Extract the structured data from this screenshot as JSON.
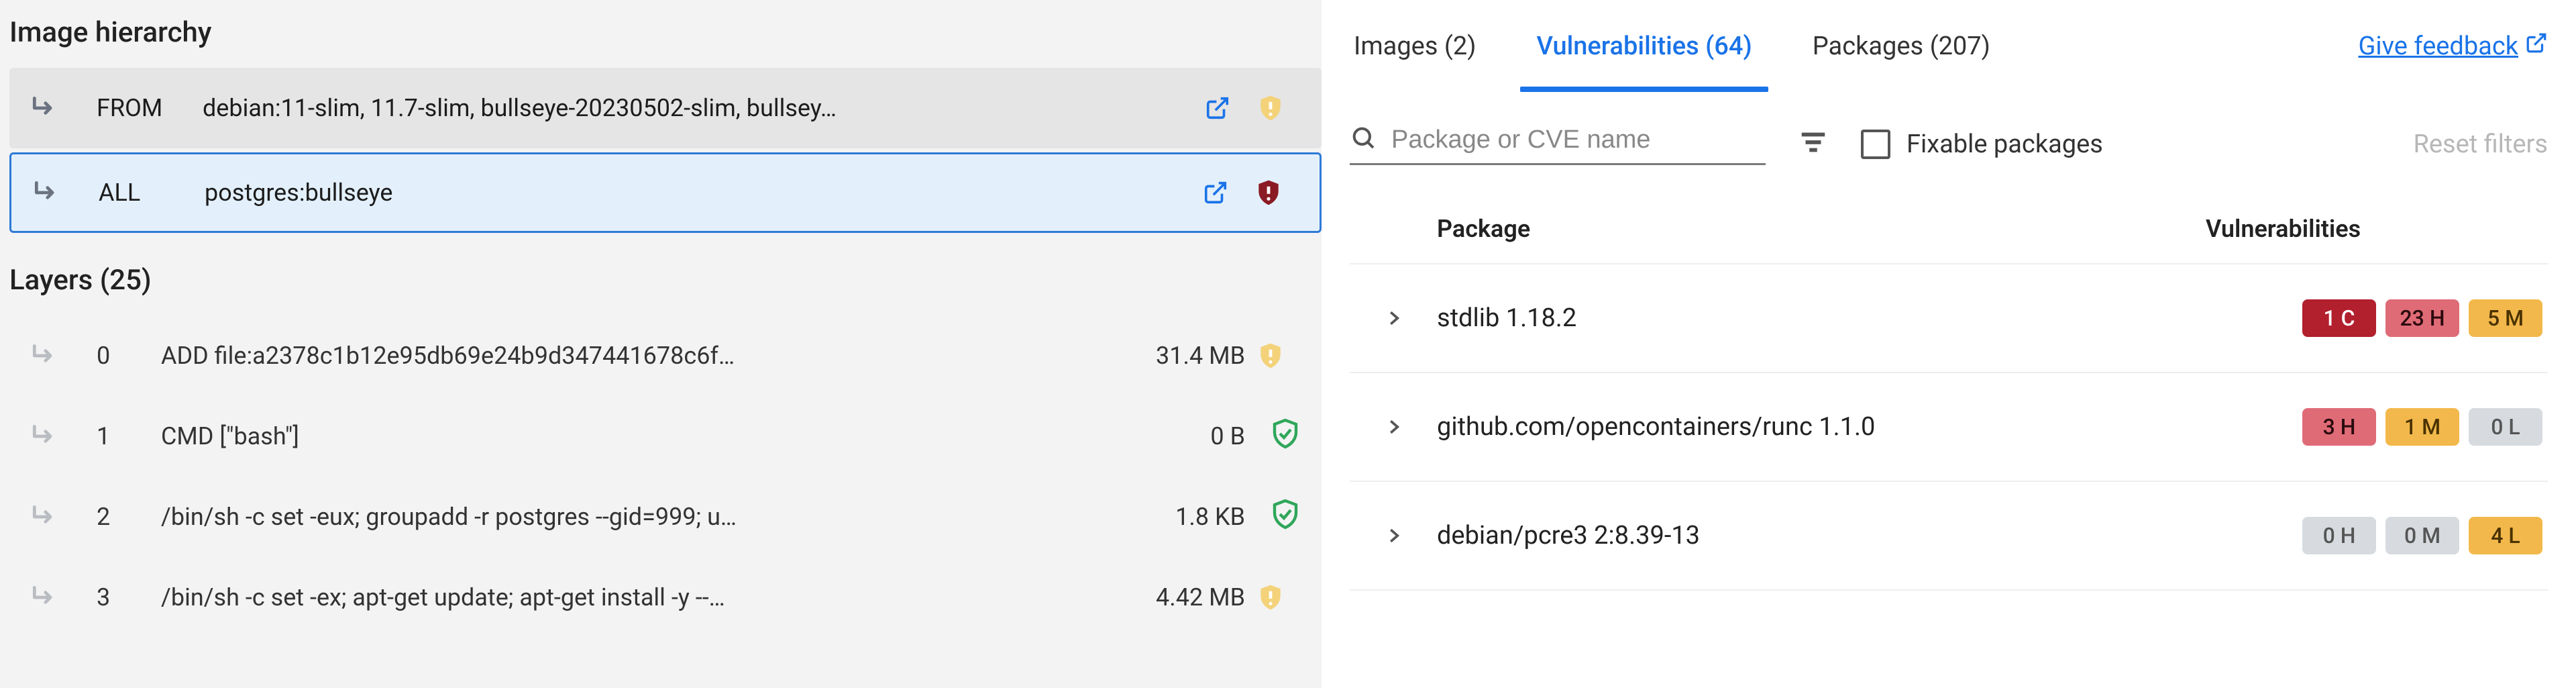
{
  "left": {
    "hierarchy_title": "Image hierarchy",
    "hierarchy": [
      {
        "tag": "FROM",
        "text": "debian:11-slim, 11.7-slim, bullseye-20230502-slim, bullsey…",
        "status": "warn-soft",
        "selected": false
      },
      {
        "tag": "ALL",
        "text": "postgres:bullseye",
        "status": "crit",
        "selected": true
      }
    ],
    "layers_title": "Layers (25)",
    "layers": [
      {
        "idx": "0",
        "cmd": "ADD file:a2378c1b12e95db69e24b9d347441678c6f…",
        "size": "31.4 MB",
        "status": "warn-soft"
      },
      {
        "idx": "1",
        "cmd": "CMD [\"bash\"]",
        "size": "0 B",
        "status": "ok"
      },
      {
        "idx": "2",
        "cmd": "/bin/sh -c set -eux; groupadd -r postgres --gid=999; u…",
        "size": "1.8 KB",
        "status": "ok"
      },
      {
        "idx": "3",
        "cmd": "/bin/sh -c set -ex; apt-get update; apt-get install -y --…",
        "size": "4.42 MB",
        "status": "warn-soft"
      }
    ]
  },
  "right": {
    "tabs": [
      {
        "label": "Images (2)",
        "active": false
      },
      {
        "label": "Vulnerabilities (64)",
        "active": true
      },
      {
        "label": "Packages (207)",
        "active": false
      }
    ],
    "feedback_label": "Give feedback",
    "search_placeholder": "Package or CVE name",
    "fixable_label": "Fixable packages",
    "reset_label": "Reset filters",
    "columns": {
      "package": "Package",
      "vulns": "Vulnerabilities"
    },
    "rows": [
      {
        "package": "stdlib 1.18.2",
        "badges": [
          {
            "text": "1 C",
            "cls": "crit"
          },
          {
            "text": "23 H",
            "cls": "high"
          },
          {
            "text": "5 M",
            "cls": "med"
          }
        ]
      },
      {
        "package": "github.com/opencontainers/runc 1.1.0",
        "badges": [
          {
            "text": "3 H",
            "cls": "high"
          },
          {
            "text": "1 M",
            "cls": "med"
          },
          {
            "text": "0 L",
            "cls": "zero"
          }
        ]
      },
      {
        "package": "debian/pcre3 2:8.39-13",
        "badges": [
          {
            "text": "0 H",
            "cls": "zero"
          },
          {
            "text": "0 M",
            "cls": "zero"
          },
          {
            "text": "4 L",
            "cls": "med"
          }
        ]
      }
    ]
  }
}
